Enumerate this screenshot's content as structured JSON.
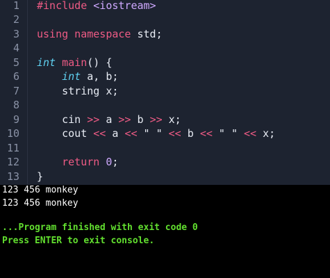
{
  "editor": {
    "lines": [
      {
        "num": "1",
        "tokens": [
          {
            "t": "#include ",
            "c": "directive"
          },
          {
            "t": "<iostream>",
            "c": "header"
          }
        ]
      },
      {
        "num": "2",
        "tokens": []
      },
      {
        "num": "3",
        "tokens": [
          {
            "t": "using namespace ",
            "c": "keyword"
          },
          {
            "t": "std;",
            "c": "plain"
          }
        ]
      },
      {
        "num": "4",
        "tokens": []
      },
      {
        "num": "5",
        "tokens": [
          {
            "t": "int",
            "c": "type"
          },
          {
            "t": " ",
            "c": "plain"
          },
          {
            "t": "main",
            "c": "func"
          },
          {
            "t": "() {",
            "c": "plain"
          }
        ]
      },
      {
        "num": "6",
        "tokens": [
          {
            "t": "    ",
            "c": "plain"
          },
          {
            "t": "int",
            "c": "type"
          },
          {
            "t": " a, b;",
            "c": "plain"
          }
        ]
      },
      {
        "num": "7",
        "tokens": [
          {
            "t": "    string x;",
            "c": "plain"
          }
        ]
      },
      {
        "num": "8",
        "tokens": []
      },
      {
        "num": "9",
        "tokens": [
          {
            "t": "    cin ",
            "c": "plain"
          },
          {
            "t": ">>",
            "c": "op"
          },
          {
            "t": " a ",
            "c": "plain"
          },
          {
            "t": ">>",
            "c": "op"
          },
          {
            "t": " b ",
            "c": "plain"
          },
          {
            "t": ">>",
            "c": "op"
          },
          {
            "t": " x;",
            "c": "plain"
          }
        ]
      },
      {
        "num": "10",
        "tokens": [
          {
            "t": "    cout ",
            "c": "plain"
          },
          {
            "t": "<<",
            "c": "op"
          },
          {
            "t": " a ",
            "c": "plain"
          },
          {
            "t": "<<",
            "c": "op"
          },
          {
            "t": " \" \" ",
            "c": "string"
          },
          {
            "t": "<<",
            "c": "op"
          },
          {
            "t": " b ",
            "c": "plain"
          },
          {
            "t": "<<",
            "c": "op"
          },
          {
            "t": " \" \" ",
            "c": "string"
          },
          {
            "t": "<<",
            "c": "op"
          },
          {
            "t": " x;",
            "c": "plain"
          }
        ]
      },
      {
        "num": "11",
        "tokens": []
      },
      {
        "num": "12",
        "tokens": [
          {
            "t": "    ",
            "c": "plain"
          },
          {
            "t": "return",
            "c": "keyword"
          },
          {
            "t": " ",
            "c": "plain"
          },
          {
            "t": "0",
            "c": "number"
          },
          {
            "t": ";",
            "c": "plain"
          }
        ]
      },
      {
        "num": "13",
        "tokens": [
          {
            "t": "}",
            "c": "plain"
          }
        ]
      }
    ]
  },
  "console": {
    "output_lines": [
      "123 456 monkey",
      "123 456 monkey"
    ],
    "status_lines": [
      "...Program finished with exit code 0",
      "Press ENTER to exit console."
    ]
  },
  "colors": {
    "editor_bg": "#1d2330",
    "keyword": "#ee5b85",
    "type": "#5fd0f0",
    "header": "#cfa9ff",
    "console_status": "#62df2f"
  }
}
